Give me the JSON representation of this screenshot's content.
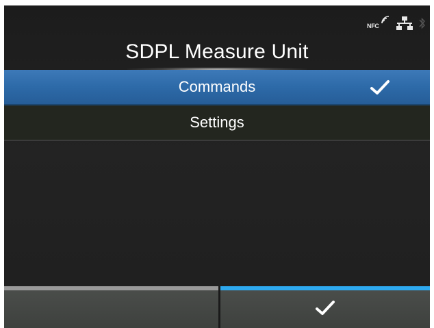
{
  "status_bar": {
    "nfc_label": "NFC",
    "icons": [
      "nfc-icon",
      "network-icon",
      "bluetooth-icon"
    ]
  },
  "page": {
    "title": "SDPL Measure Unit"
  },
  "menu": {
    "items": [
      {
        "label": "Commands",
        "selected": true
      },
      {
        "label": "Settings",
        "selected": false
      }
    ]
  },
  "function_bar": {
    "left_label": "",
    "right_icon": "check-icon"
  },
  "colors": {
    "selected_row": "#2d6aa8",
    "function_accent": "#2eaaf0",
    "background": "#1f1f1f",
    "text": "#ffffff"
  }
}
